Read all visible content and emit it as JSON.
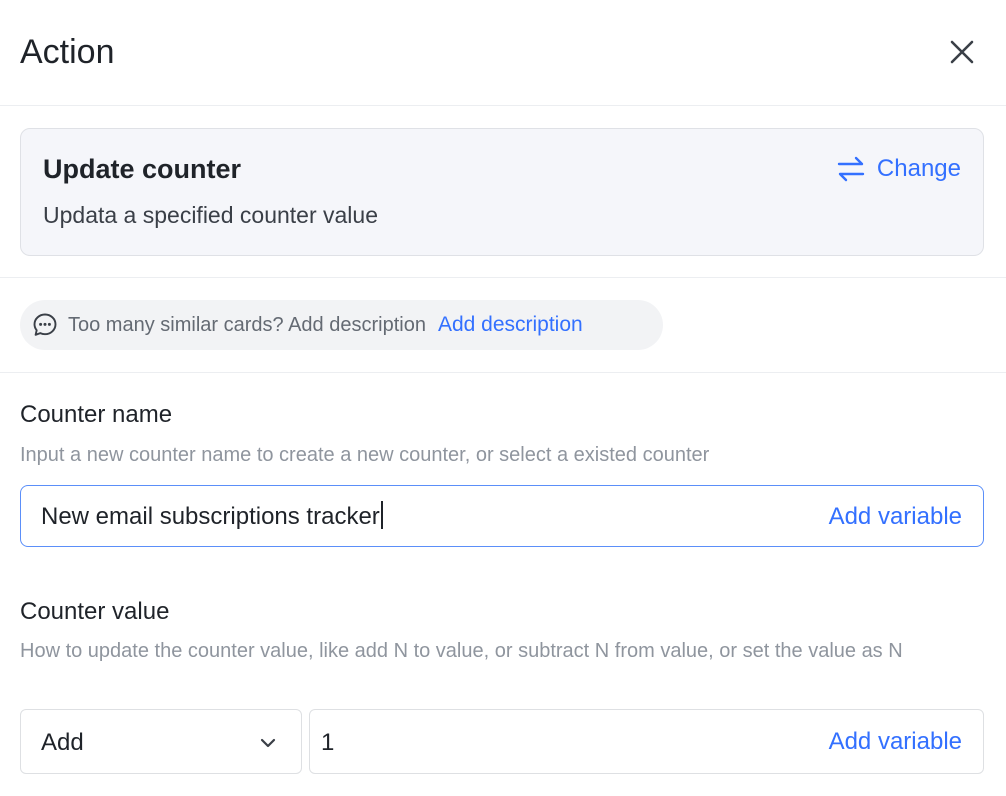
{
  "panel": {
    "title": "Action",
    "close_icon": "close-icon"
  },
  "action_card": {
    "title": "Update counter",
    "description": "Updata a specified counter value",
    "change_label": "Change",
    "change_icon": "swap-arrows-icon"
  },
  "hint": {
    "icon": "chat-bubble-icon",
    "text": "Too many similar cards? Add description",
    "link": "Add description"
  },
  "counter_name": {
    "label": "Counter name",
    "help": "Input a new counter name to create a new counter, or select a existed counter",
    "value": "New email subscriptions tracker",
    "add_variable": "Add variable"
  },
  "counter_value": {
    "label": "Counter value",
    "help": "How to update the counter value, like add N to value, or subtract N from value, or set the value as N",
    "operation": "Add",
    "amount": "1",
    "add_variable": "Add variable"
  },
  "colors": {
    "accent": "#3370ff",
    "focus_border": "#5b8ff9",
    "card_bg": "#f5f6fa",
    "hint_bg": "#f2f3f5"
  }
}
